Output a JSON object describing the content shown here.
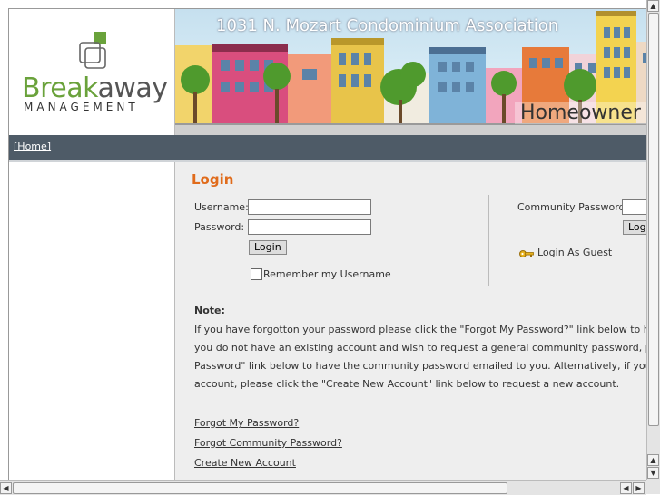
{
  "header": {
    "logo_word_part1": "Break",
    "logo_word_part2": "away",
    "logo_sub": "MANAGEMENT",
    "banner_title": "1031 N. Mozart Condominium Association",
    "banner_sub": "Homeowner"
  },
  "nav": {
    "home": "[Home]"
  },
  "login": {
    "title": "Login",
    "username_label": "Username:",
    "password_label": "Password:",
    "username_value": "",
    "password_value": "",
    "login_button": "Login",
    "remember_label": "Remember my Username",
    "remember_checked": false,
    "community_password_label": "Community Password:",
    "community_password_value": "",
    "community_login_button": "Login",
    "guest_link": "Login As Guest"
  },
  "note": {
    "heading": "Note:",
    "lines": [
      "If you have forgotton your password please click the \"Forgot My Password?\" link below to have your pa",
      "you do not have an existing account and wish to request a general community password, please click",
      "Password\" link below to have the community password emailed to you. Alternatively, if you would like",
      "account, please click the \"Create New Account\" link below to request a new account."
    ]
  },
  "links": {
    "forgot_password": "Forgot My Password?",
    "forgot_community_password": "Forgot Community Password?",
    "create_account": "Create New Account"
  },
  "colors": {
    "accent": "#e06b1b",
    "nav_bg": "#4e5b67",
    "content_bg": "#eeeeee",
    "logo_green": "#6aa23b"
  }
}
